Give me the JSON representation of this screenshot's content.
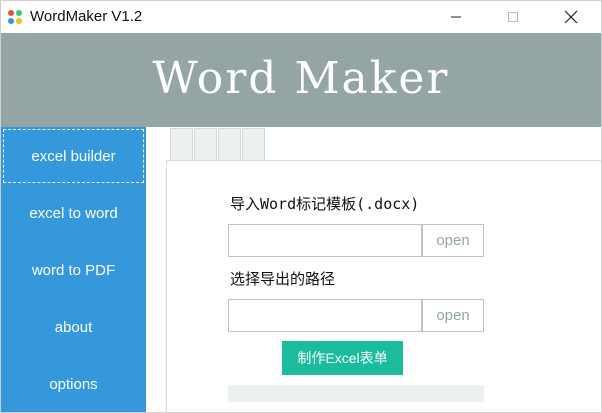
{
  "window": {
    "title": "WordMaker V1.2"
  },
  "banner": {
    "title": "Word Maker"
  },
  "sidebar": {
    "items": [
      {
        "label": "excel builder",
        "active": true
      },
      {
        "label": "excel to word",
        "active": false
      },
      {
        "label": "word to PDF",
        "active": false
      },
      {
        "label": "about",
        "active": false
      },
      {
        "label": "options",
        "active": false
      }
    ]
  },
  "form": {
    "template_label": "导入Word标记模板(.docx)",
    "template_value": "",
    "template_open_label": "open",
    "export_label": "选择导出的路径",
    "export_value": "",
    "export_open_label": "open",
    "make_button_label": "制作Excel表单",
    "progress": 0
  },
  "colors": {
    "banner": "#95a5a6",
    "sidebar": "#3498db",
    "accent": "#1abc9c",
    "tab": "#ecf0f1"
  },
  "icons": {
    "app": "colored-dots-app-icon",
    "minimize": "minimize-icon",
    "maximize": "maximize-icon",
    "close": "close-icon"
  }
}
